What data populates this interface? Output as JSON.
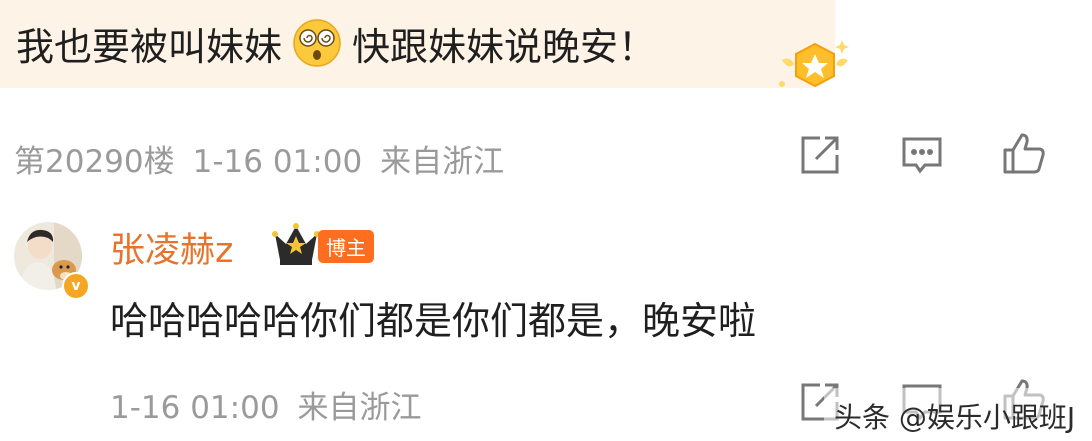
{
  "comment": {
    "text_before": "我也要被叫妹妹",
    "emoji": "dizzy-face-emoji",
    "text_after": "快跟妹妹说晚安！",
    "floor": "第20290楼",
    "date": "1-16 01:00",
    "source": "来自浙江"
  },
  "reply": {
    "username": "张凌赫z",
    "badge": "博主",
    "text": "哈哈哈哈哈你们都是你们都是，晚安啦",
    "date": "1-16 01:00",
    "source": "来自浙江"
  },
  "actions": [
    "share-icon",
    "comment-icon",
    "like-icon"
  ],
  "watermark": "头条 @娱乐小跟班J",
  "colors": {
    "bubble_bg": "#fdf3e6",
    "username": "#e8742b",
    "badge_bg": "#ff6e1e",
    "meta_text": "#9a9a9a",
    "verified": "#f5a623"
  }
}
